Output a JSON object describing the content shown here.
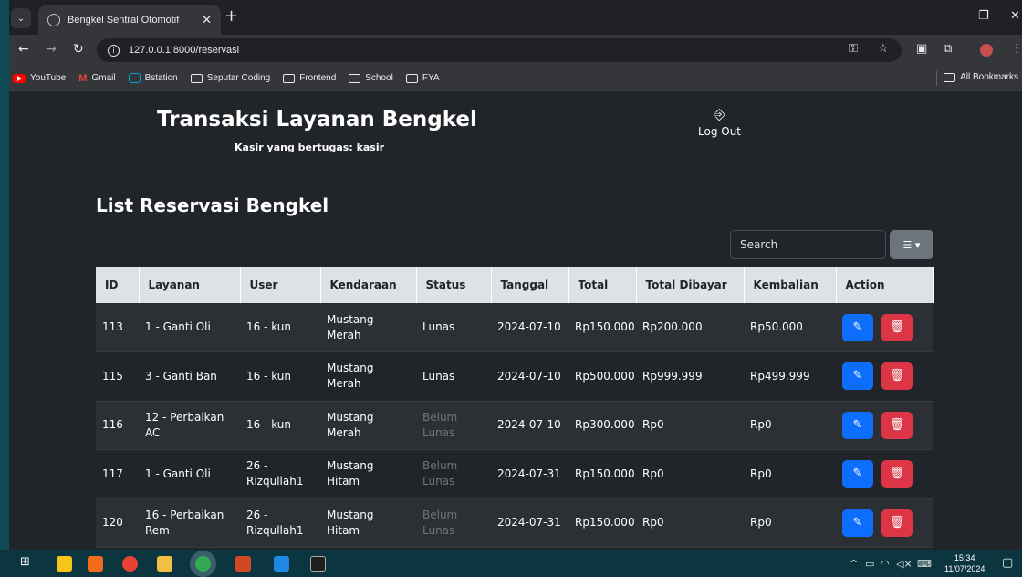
{
  "browser": {
    "tab_title": "Bengkel Sentral Otomotif",
    "url": "127.0.0.1:8000/reservasi",
    "bookmarks": [
      "YouTube",
      "Gmail",
      "Bstation",
      "Seputar Coding",
      "Frontend",
      "School",
      "FYA"
    ],
    "all_bookmarks": "All Bookmarks"
  },
  "header": {
    "title": "Transaksi Layanan Bengkel",
    "subtitle": "Kasir yang bertugas: kasir",
    "logout_label": "Log Out"
  },
  "main": {
    "title": "List Reservasi Bengkel",
    "search_placeholder": "Search"
  },
  "table": {
    "columns": [
      "ID",
      "Layanan",
      "User",
      "Kendaraan",
      "Status",
      "Tanggal",
      "Total",
      "Total Dibayar",
      "Kembalian",
      "Action"
    ],
    "rows": [
      {
        "id": "113",
        "layanan": "1 - Ganti Oli",
        "user": "16 - kun",
        "kendaraan": "Mustang Merah",
        "status": "Lunas",
        "tanggal": "2024-07-10",
        "total": "Rp150.000",
        "dibayar": "Rp200.000",
        "kembalian": "Rp50.000"
      },
      {
        "id": "115",
        "layanan": "3 - Ganti Ban",
        "user": "16 - kun",
        "kendaraan": "Mustang Merah",
        "status": "Lunas",
        "tanggal": "2024-07-10",
        "total": "Rp500.000",
        "dibayar": "Rp999.999",
        "kembalian": "Rp499.999"
      },
      {
        "id": "116",
        "layanan": "12 - Perbaikan AC",
        "user": "16 - kun",
        "kendaraan": "Mustang Merah",
        "status": "Belum Lunas",
        "tanggal": "2024-07-10",
        "total": "Rp300.000",
        "dibayar": "Rp0",
        "kembalian": "Rp0"
      },
      {
        "id": "117",
        "layanan": "1 - Ganti Oli",
        "user": "26 - Rizqullah1",
        "kendaraan": "Mustang Hitam",
        "status": "Belum Lunas",
        "tanggal": "2024-07-31",
        "total": "Rp150.000",
        "dibayar": "Rp0",
        "kembalian": "Rp0"
      },
      {
        "id": "120",
        "layanan": "16 - Perbaikan Rem",
        "user": "26 - Rizqullah1",
        "kendaraan": "Mustang Hitam",
        "status": "Belum Lunas",
        "tanggal": "2024-07-31",
        "total": "Rp150.000",
        "dibayar": "Rp0",
        "kembalian": "Rp0"
      }
    ]
  },
  "taskbar": {
    "time": "15:34",
    "date": "11/07/2024"
  },
  "colors": {
    "edit_button": "#0d6efd",
    "delete_button": "#dc3545",
    "page_background": "#212529"
  }
}
